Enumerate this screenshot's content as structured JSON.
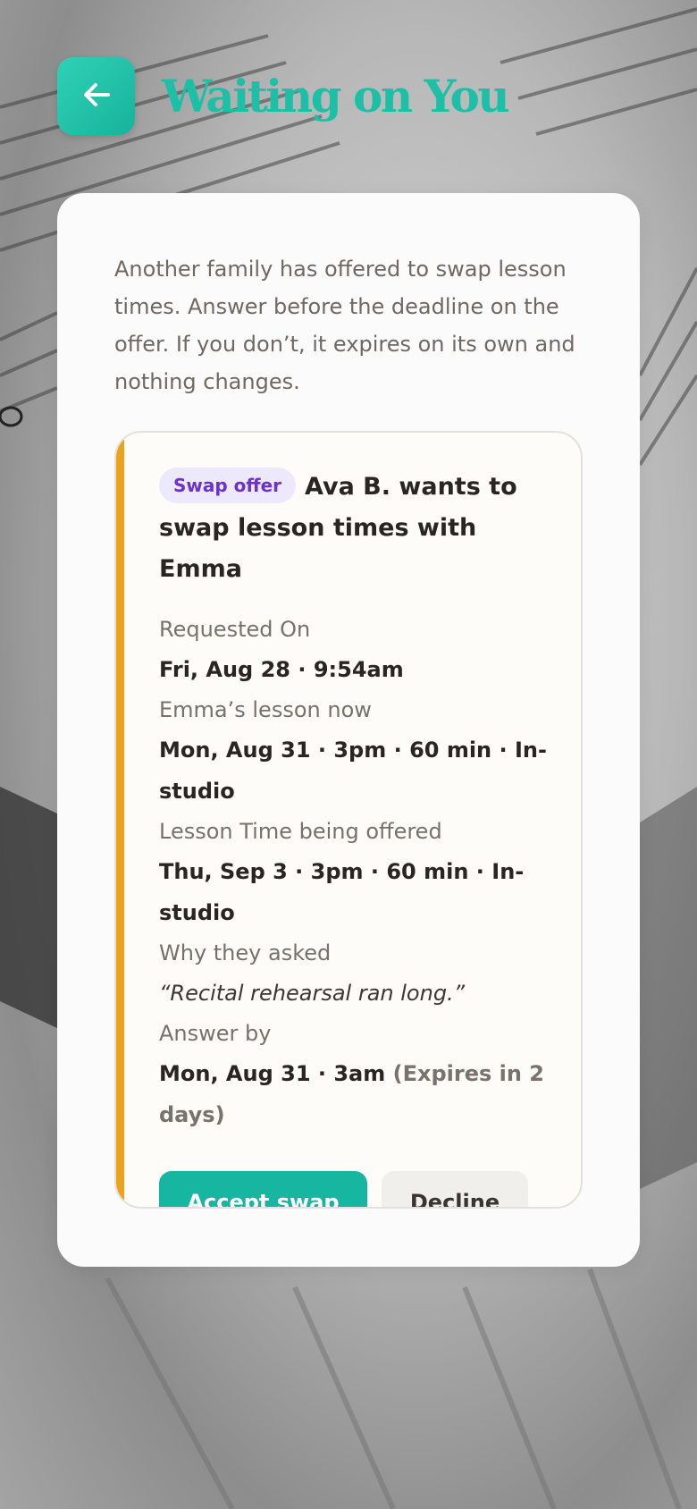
{
  "header": {
    "back_icon": "arrow-left-icon",
    "title": "Waiting on You"
  },
  "intro": "Another family has offered to swap lesson times. Answer before the deadline on the offer. If you don’t, it expires on its own and nothing changes.",
  "offer": {
    "badge": "Swap offer",
    "title": "Ava B. wants to swap lesson times with Emma",
    "requested_label": "Requested On",
    "requested_value": "Fri, Aug 28 · 9:54am",
    "current_label": "Emma’s lesson now",
    "current_value": "Mon, Aug 31 · 3pm · 60 min · In-studio",
    "offered_label": "Lesson Time being offered",
    "offered_value": "Thu, Sep 3 · 3pm · 60 min · In-studio",
    "reason_label": "Why they asked",
    "reason_value": "“Recital rehearsal ran long.”",
    "deadline_label": "Answer by",
    "deadline_value": "Mon, Aug 31 · 3am",
    "deadline_note": "(Expires in 2 days)",
    "accept_label": "Accept swap",
    "decline_label": "Decline"
  },
  "colors": {
    "accent": "#17b6a0",
    "title": "#1cc0a6",
    "stripe": "#eca31a",
    "badge_text": "#6b33c9",
    "badge_bg": "#ece9fc"
  }
}
